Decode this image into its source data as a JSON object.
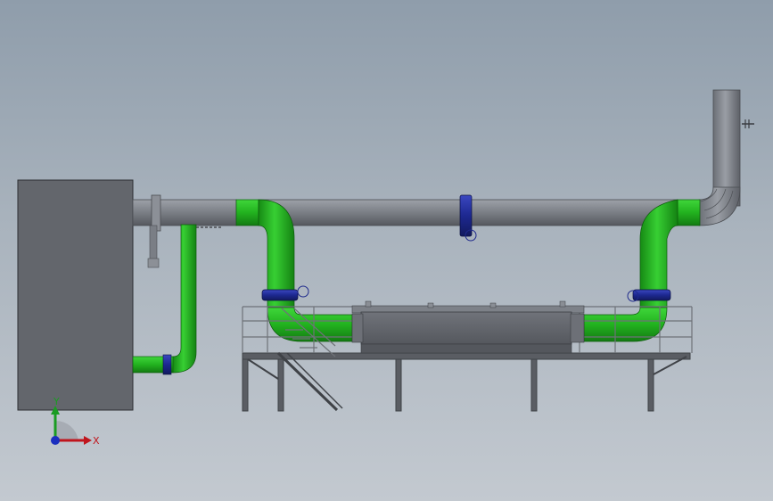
{
  "viewport": {
    "background_top": "#8f9dab",
    "background_bottom": "#c3c9d0"
  },
  "colors": {
    "pipe_gray": "#7d8189",
    "pipe_gray_dark": "#5b5f66",
    "pipe_green": "#21b320",
    "pipe_green_dark": "#137a12",
    "valve_blue": "#1f2a8c",
    "tank": "#63666c",
    "frame": "#4a4d52",
    "axis_x": "#c0151d",
    "axis_y": "#1a9c22",
    "axis_z": "#1b2fbf"
  },
  "icons": {
    "triad": "coordinate-triad-icon",
    "valve": "butterfly-valve-icon"
  },
  "triad": {
    "x_label": "X",
    "y_label": "Y"
  }
}
